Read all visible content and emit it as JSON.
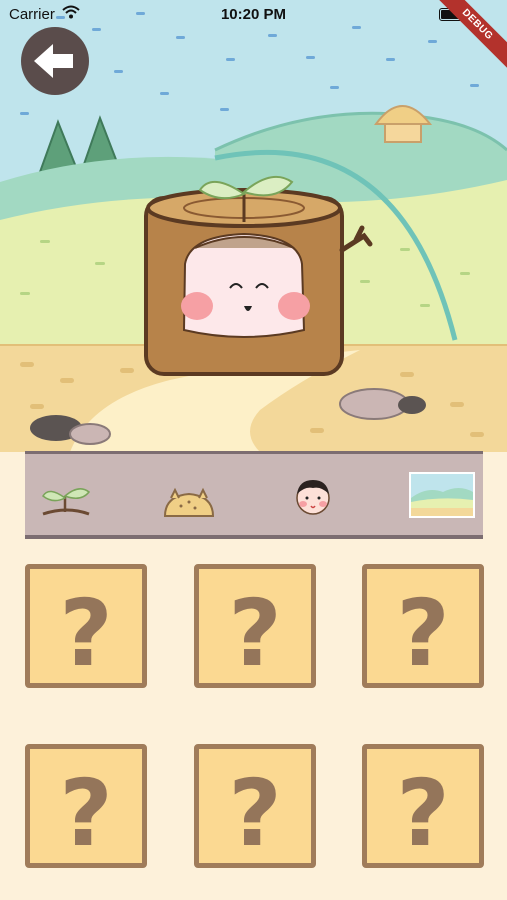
{
  "status_bar": {
    "carrier": "Carrier",
    "time": "10:20 PM"
  },
  "debug_banner": "DEBUG",
  "back_button": {
    "icon": "arrow-left-icon"
  },
  "scene": {
    "character": "tree-stump-girl-with-sprout",
    "background": "hills-and-path"
  },
  "stage_strip": {
    "items": [
      {
        "name": "sprout",
        "icon": "sprout-icon"
      },
      {
        "name": "stump",
        "icon": "stump-icon"
      },
      {
        "name": "face",
        "icon": "face-icon"
      },
      {
        "name": "background",
        "icon": "background-thumbnail"
      }
    ]
  },
  "cards": [
    {
      "label": "?"
    },
    {
      "label": "?"
    },
    {
      "label": "?"
    },
    {
      "label": "?"
    },
    {
      "label": "?"
    },
    {
      "label": "?"
    }
  ],
  "colors": {
    "sky": "#bfe4ec",
    "hill_green": "#a2d9c2",
    "hill_yellow": "#e6f0b0",
    "ground": "#f3d89a",
    "card_fill": "#fbd992",
    "card_border": "#a07c5a",
    "strip": "#c9b7b6",
    "back_button": "#5a4c4b",
    "debug": "#b3322c"
  }
}
